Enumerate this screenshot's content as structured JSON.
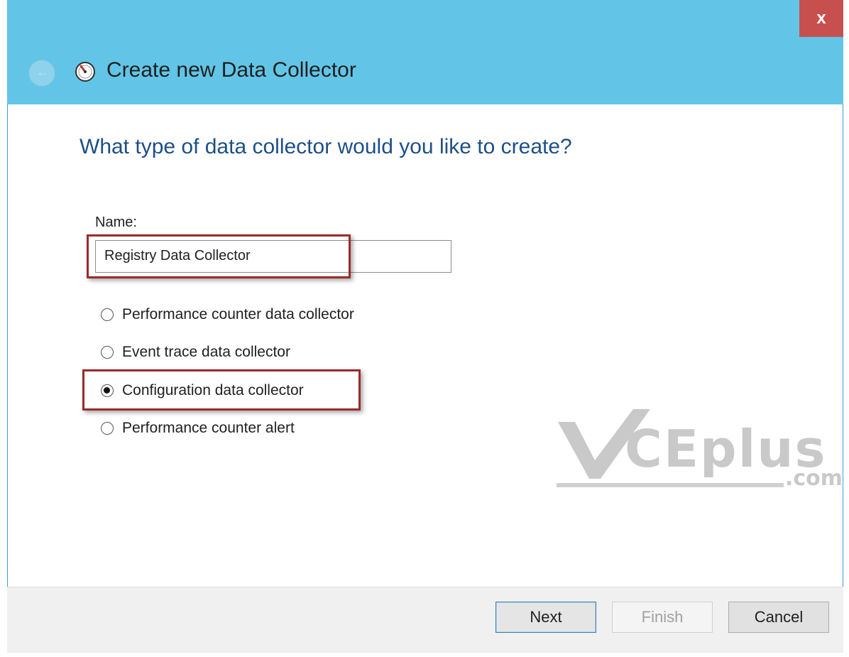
{
  "window": {
    "title": "Create new Data Collector",
    "close_label": "x"
  },
  "question": "What type of data collector would you like to create?",
  "name_field": {
    "label": "Name:",
    "value": "Registry Data Collector"
  },
  "options": [
    {
      "label": "Performance counter data collector",
      "checked": false
    },
    {
      "label": "Event trace data collector",
      "checked": false
    },
    {
      "label": "Configuration data collector",
      "checked": true
    },
    {
      "label": "Performance counter alert",
      "checked": false
    }
  ],
  "watermark": {
    "text": "CEplus",
    "suffix": ".com"
  },
  "buttons": {
    "next": "Next",
    "finish": "Finish",
    "cancel": "Cancel"
  },
  "colors": {
    "titlebar": "#62c5e7",
    "close": "#c7504f",
    "question": "#1d4f86",
    "highlight": "#9b2b2b"
  },
  "icons": {
    "back": "back-arrow-icon",
    "app": "performance-monitor-icon",
    "close": "close-icon"
  }
}
